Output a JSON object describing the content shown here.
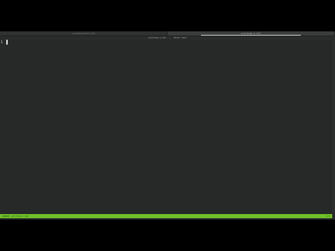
{
  "tabs": [
    {
      "label": "~/notes/draft.txt",
      "active": false
    },
    {
      "label": "untitled-1.txt",
      "active": true
    }
  ],
  "titlebar": {
    "file": "untitled-1.txt",
    "mode": "Plain Text"
  },
  "editor": {
    "line_number": "1"
  },
  "status": {
    "left": "INSERT  untitled-1.txt",
    "right": "1:1"
  },
  "colors": {
    "background": "#262928",
    "status_bar": "#6fbf2a"
  }
}
